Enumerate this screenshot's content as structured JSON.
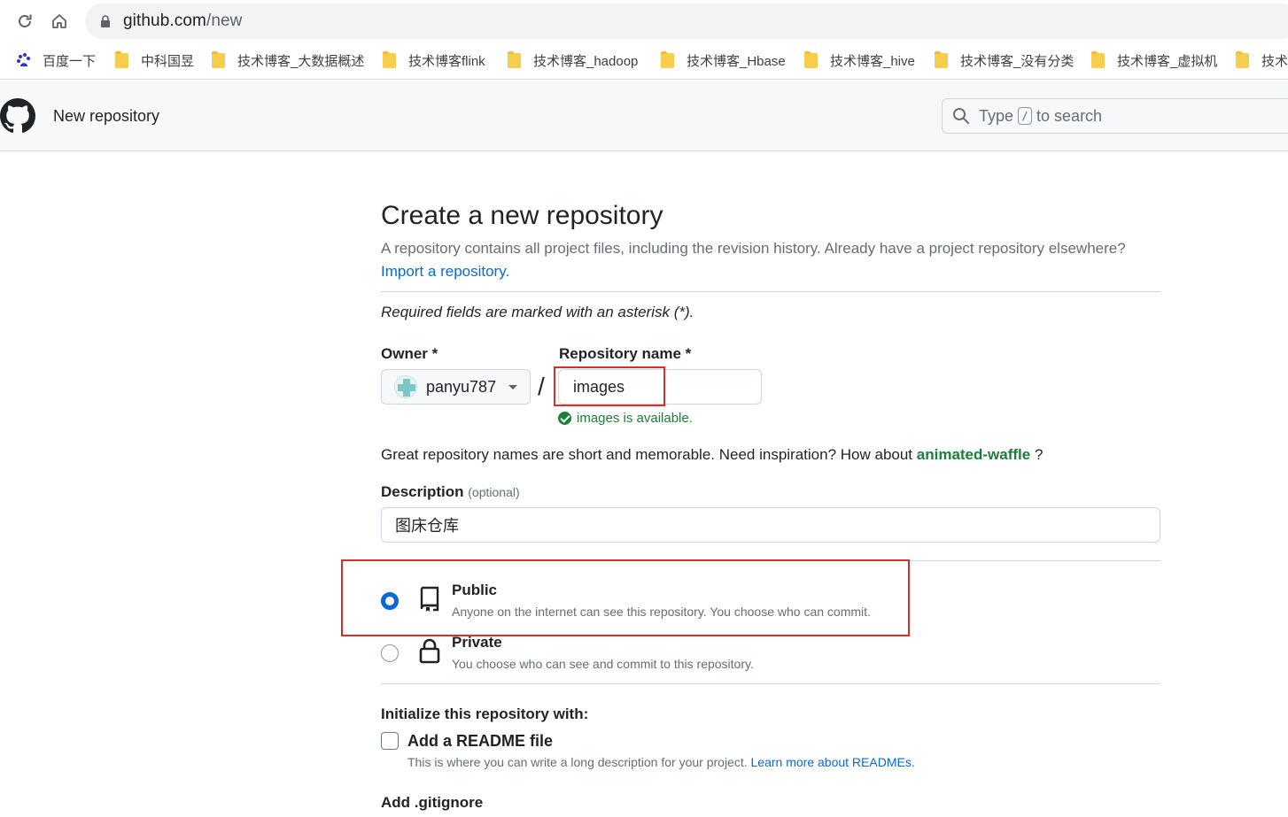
{
  "browser": {
    "url_host": "github.com",
    "url_path": "/new",
    "bookmarks": [
      "百度一下",
      "中科国昱",
      "技术博客_大数据概述",
      "技术博客flink",
      "技术博客_hadoop",
      "技术博客_Hbase",
      "技术博客_hive",
      "技术博客_没有分类",
      "技术博客_虚拟机",
      "技术"
    ]
  },
  "header": {
    "title": "New repository",
    "search_prefix": "Type",
    "search_key": "/",
    "search_suffix": "to search"
  },
  "form": {
    "title": "Create a new repository",
    "lead": "A repository contains all project files, including the revision history. Already have a project repository elsewhere?",
    "import_link": "Import a repository.",
    "required_note": "Required fields are marked with an asterisk (*).",
    "owner_label": "Owner *",
    "owner_value": "panyu787",
    "slash": "/",
    "repo_label": "Repository name *",
    "repo_value": "images",
    "available": "images is available.",
    "inspire_prefix": "Great repository names are short and memorable. Need inspiration? How about",
    "inspire_suggestion": "animated-waffle",
    "inspire_suffix": "?",
    "description_label": "Description",
    "description_optional": "(optional)",
    "description_value": "图床仓库",
    "visibility": {
      "selected": "Public",
      "public_title": "Public",
      "public_desc": "Anyone on the internet can see this repository. You choose who can commit.",
      "private_title": "Private",
      "private_desc": "You choose who can see and commit to this repository."
    },
    "init_title": "Initialize this repository with:",
    "readme_label": "Add a README file",
    "readme_desc": "This is where you can write a long description for your project.",
    "readme_link": "Learn more about READMEs.",
    "gitignore_label": "Add .gitignore"
  },
  "colors": {
    "accent": "#0969da",
    "success": "#1a7f37",
    "annotation": "#e02b27"
  }
}
